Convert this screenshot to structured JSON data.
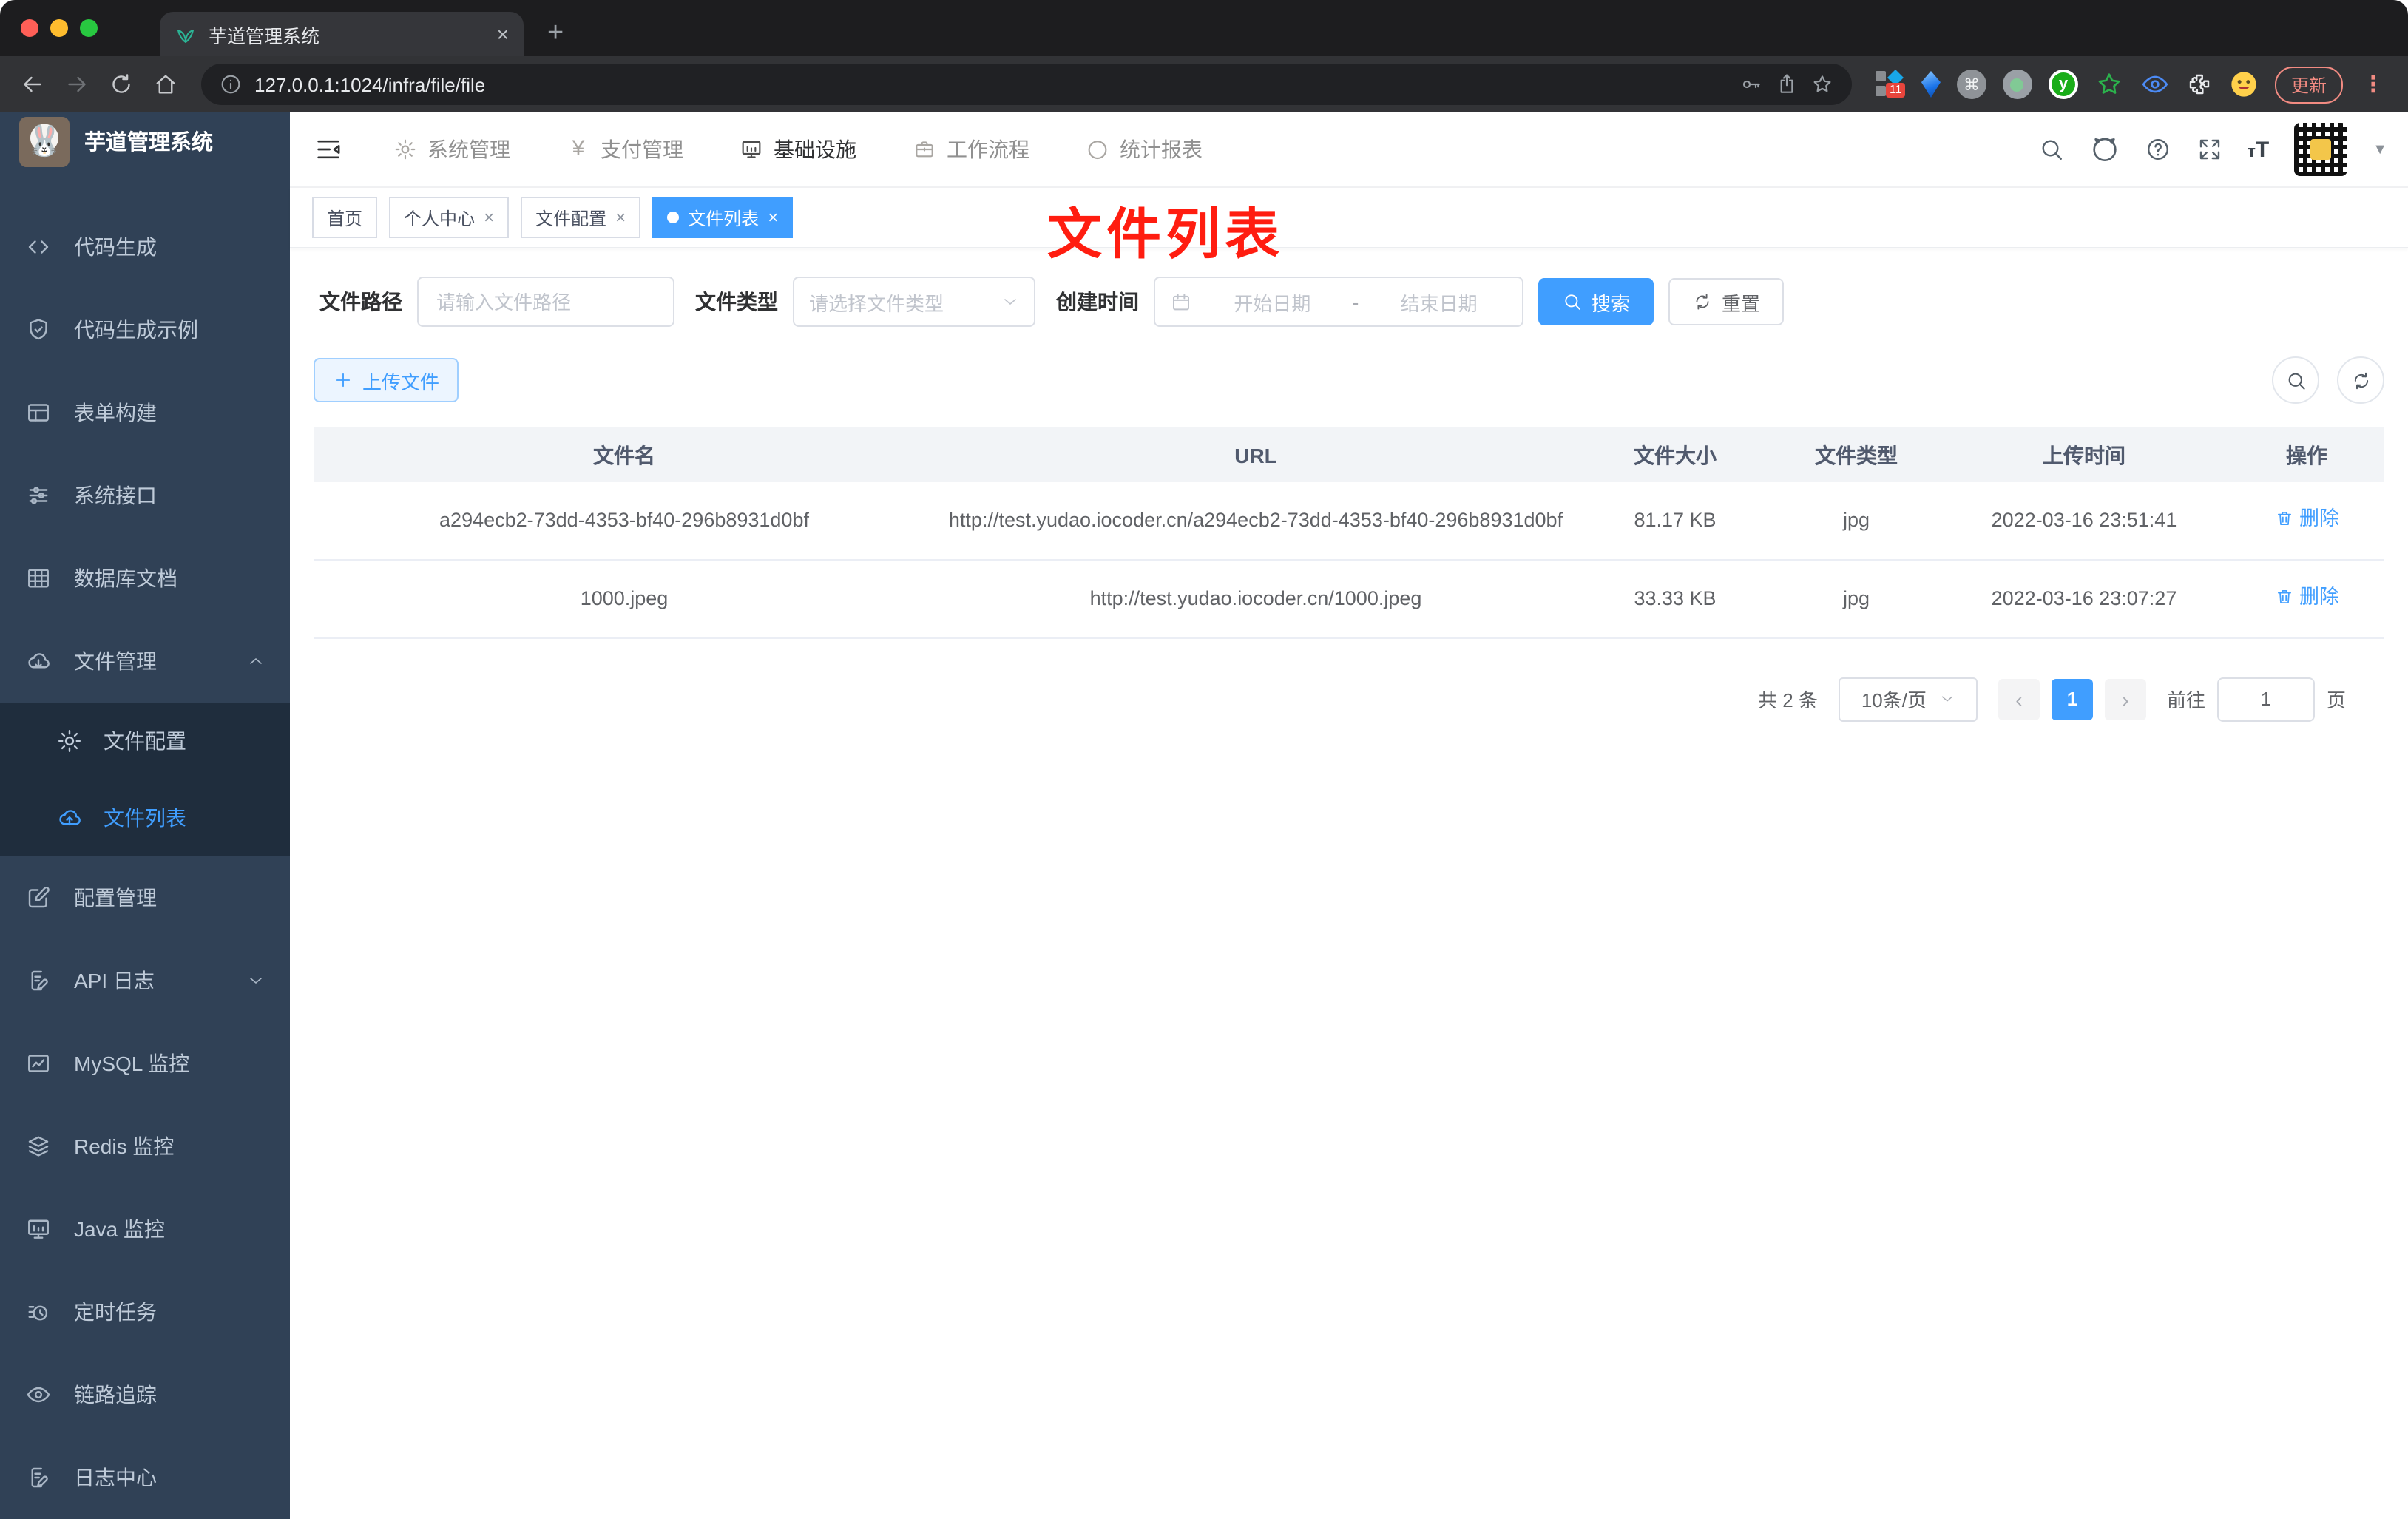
{
  "colors": {
    "accent": "#409eff",
    "sidebar_bg": "#304156",
    "submenu_bg": "#1f2d3d",
    "annotation_red": "#ff1d10",
    "browser_update_red": "#f28b82",
    "table_header_bg": "#f2f4f7"
  },
  "browser": {
    "tab": {
      "title": "芋道管理系统",
      "close": "×",
      "new_tab": "+"
    },
    "url": "127.0.0.1:1024/infra/file/file",
    "extensions_badge": "11",
    "update_label": "更新",
    "menu_dots": "⋮",
    "cmd_glyph": "⌘",
    "y_glyph": "y"
  },
  "icons": [
    "leaf-favicon-icon",
    "back-icon",
    "forward-icon",
    "reload-icon",
    "home-icon",
    "info-icon",
    "key-icon",
    "share-icon",
    "star-icon",
    "puzzle-icon",
    "search-icon",
    "github-icon",
    "help-icon",
    "fullscreen-icon",
    "font-size-icon",
    "chevron-down-icon",
    "chevron-up-icon",
    "code-icon",
    "shield-check-icon",
    "form-icon",
    "sliders-icon",
    "grid-icon",
    "cloud-download-icon",
    "gear-icon",
    "cloud-upload-icon",
    "edit-icon",
    "doc-edit-icon",
    "chart-icon",
    "layers-icon",
    "monitor-icon",
    "timer-icon",
    "eye-icon",
    "yen-icon",
    "briefcase-icon",
    "gauge-icon",
    "calendar-icon",
    "refresh-icon",
    "plus-icon",
    "trash-icon",
    "hamburger-icon"
  ],
  "sidebar": {
    "title": "芋道管理系统",
    "items": [
      {
        "label": "代码生成",
        "icon": "code-icon"
      },
      {
        "label": "代码生成示例",
        "icon": "shield-check-icon"
      },
      {
        "label": "表单构建",
        "icon": "form-icon"
      },
      {
        "label": "系统接口",
        "icon": "sliders-icon"
      },
      {
        "label": "数据库文档",
        "icon": "grid-icon"
      },
      {
        "label": "文件管理",
        "icon": "cloud-download-icon",
        "expanded": true,
        "children": [
          {
            "label": "文件配置",
            "icon": "gear-icon",
            "active": false
          },
          {
            "label": "文件列表",
            "icon": "cloud-upload-icon",
            "active": true
          }
        ]
      },
      {
        "label": "配置管理",
        "icon": "edit-icon"
      },
      {
        "label": "API 日志",
        "icon": "doc-edit-icon",
        "collapsed": true
      },
      {
        "label": "MySQL 监控",
        "icon": "chart-icon"
      },
      {
        "label": "Redis 监控",
        "icon": "layers-icon"
      },
      {
        "label": "Java 监控",
        "icon": "monitor-icon"
      },
      {
        "label": "定时任务",
        "icon": "timer-icon"
      },
      {
        "label": "链路追踪",
        "icon": "eye-icon"
      },
      {
        "label": "日志中心",
        "icon": "doc-edit-icon"
      }
    ]
  },
  "topnav": {
    "items": [
      {
        "label": "系统管理",
        "icon": "gear-icon",
        "active": false
      },
      {
        "label": "支付管理",
        "icon": "yen-icon",
        "active": false
      },
      {
        "label": "基础设施",
        "icon": "monitor-icon",
        "active": true
      },
      {
        "label": "工作流程",
        "icon": "briefcase-icon",
        "active": false
      },
      {
        "label": "统计报表",
        "icon": "gauge-icon",
        "active": false
      }
    ]
  },
  "tags": [
    {
      "label": "首页",
      "closable": false,
      "active": false
    },
    {
      "label": "个人中心",
      "closable": true,
      "active": false
    },
    {
      "label": "文件配置",
      "closable": true,
      "active": false
    },
    {
      "label": "文件列表",
      "closable": true,
      "active": true
    }
  ],
  "annotation": "文件列表",
  "filters": {
    "path_label": "文件路径",
    "path_placeholder": "请输入文件路径",
    "type_label": "文件类型",
    "type_placeholder": "请选择文件类型",
    "date_label": "创建时间",
    "date_start": "开始日期",
    "date_separator": "-",
    "date_end": "结束日期",
    "search_label": "搜索",
    "reset_label": "重置"
  },
  "toolbar": {
    "upload_label": "上传文件"
  },
  "table": {
    "headers": [
      "文件名",
      "URL",
      "文件大小",
      "文件类型",
      "上传时间",
      "操作"
    ],
    "rows": [
      {
        "name": "a294ecb2-73dd-4353-bf40-296b8931d0bf",
        "url": "http://test.yudao.iocoder.cn/a294ecb2-73dd-4353-bf40-296b8931d0bf",
        "size": "81.17 KB",
        "type": "jpg",
        "time": "2022-03-16 23:51:41",
        "action": "删除"
      },
      {
        "name": "1000.jpeg",
        "url": "http://test.yudao.iocoder.cn/1000.jpeg",
        "size": "33.33 KB",
        "type": "jpg",
        "time": "2022-03-16 23:07:27",
        "action": "删除"
      }
    ]
  },
  "pagination": {
    "total": "共 2 条",
    "page_size": "10条/页",
    "prev": "‹",
    "current": "1",
    "next": "›",
    "goto_label": "前往",
    "goto_value": "1",
    "unit_label": "页"
  }
}
